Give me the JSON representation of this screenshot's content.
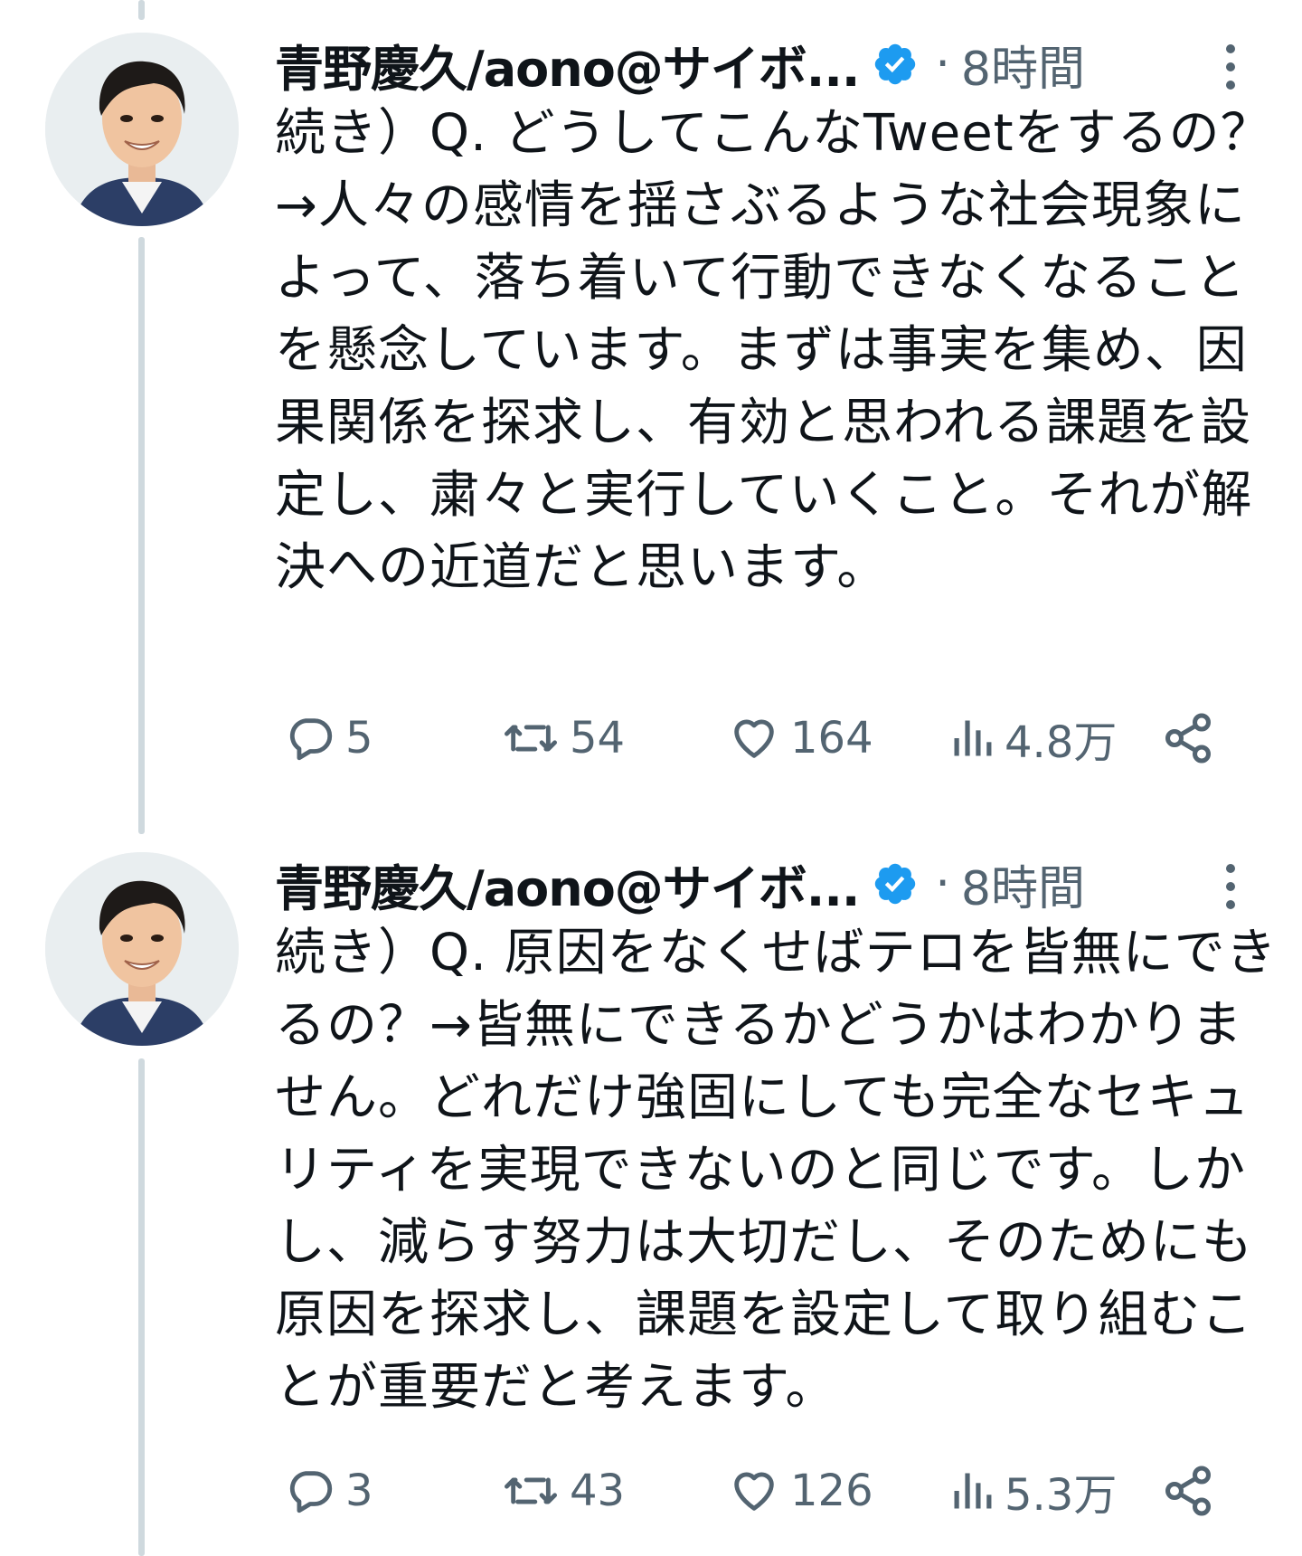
{
  "tweets": [
    {
      "display_name": "青野慶久/aono@サイボ...",
      "separator": "·",
      "time": "8時間",
      "text": "続き）Q. どうしてこんなTweetをするの？→人々の感情を揺さぶるような社会現象によって、落ち着いて行動できなくなることを懸念しています。まずは事実を集め、因果関係を探求し、有効と思われる課題を設定し、粛々と実行していくこと。それが解決への近道だと思います。",
      "replies": "5",
      "retweets": "54",
      "likes": "164",
      "views": "4.8万"
    },
    {
      "display_name": "青野慶久/aono@サイボ...",
      "separator": "·",
      "time": "8時間",
      "text": "続き）Q. 原因をなくせばテロを皆無にできるの？→皆無にできるかどうかはわかりません。どれだけ強固にしても完全なセキュリティを実現できないのと同じです。しかし、減らす努力は大切だし、そのためにも原因を探求し、課題を設定して取り組むことが重要だと考えます。",
      "replies": "3",
      "retweets": "43",
      "likes": "126",
      "views": "5.3万"
    }
  ],
  "icons": {
    "verified": "verified-badge-icon",
    "more": "more-vertical-icon",
    "reply": "reply-icon",
    "retweet": "retweet-icon",
    "like": "heart-icon",
    "views": "views-bar-chart-icon",
    "share": "share-icon"
  },
  "colors": {
    "text": "#0f1419",
    "secondary": "#536471",
    "verified": "#1d9bf0",
    "thread_line": "#cfd9de"
  }
}
